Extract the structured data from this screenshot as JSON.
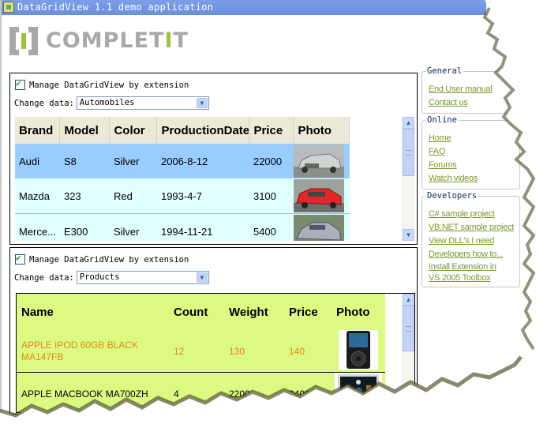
{
  "window": {
    "title": "DataGridView 1.1 demo application"
  },
  "logo": {
    "text_main": "COMPLET",
    "text_accent": "I",
    "text_end": "T"
  },
  "panel1": {
    "checkbox_label": "Manage DataGridView by extension",
    "checkbox_checked": true,
    "change_label": "Change data:",
    "combo_value": "Automobiles",
    "columns": [
      "Brand",
      "Model",
      "Color",
      "ProductionDate",
      "Price",
      "Photo"
    ],
    "rows": [
      {
        "brand": "Audi",
        "model": "S8",
        "color": "Silver",
        "date": "2006-8-12",
        "price": "22000",
        "photo": "silver-car",
        "selected": true
      },
      {
        "brand": "Mazda",
        "model": "323",
        "color": "Red",
        "date": "1993-4-7",
        "price": "3100",
        "photo": "red-car",
        "selected": false
      },
      {
        "brand": "Merce...",
        "model": "E300",
        "color": "Silver",
        "date": "1994-11-21",
        "price": "5400",
        "photo": "silver-sedan",
        "selected": false
      }
    ]
  },
  "panel2": {
    "checkbox_label": "Manage DataGridView by extension",
    "checkbox_checked": true,
    "change_label": "Change data:",
    "combo_value": "Products",
    "columns": [
      "Name",
      "Count",
      "Weight",
      "Price",
      "Photo"
    ],
    "rows": [
      {
        "name": "APPLE IPOD 60GB BLACK MA147FB",
        "count": "12",
        "weight": "130",
        "price": "140",
        "photo": "ipod",
        "highlight": true
      },
      {
        "name": "APPLE MACBOOK MA700ZH",
        "count": "4",
        "weight": "2200",
        "price": "2400",
        "photo": "macbook",
        "highlight": false
      }
    ]
  },
  "sidebar": {
    "groups": [
      {
        "title": "General",
        "links": [
          "End User manual",
          "Contact us"
        ]
      },
      {
        "title": "Online",
        "links": [
          "Home",
          "FAQ",
          "Forums",
          "Watch videos"
        ]
      },
      {
        "title": "Developers",
        "links": [
          "C# sample project",
          "VB.NET sample project",
          "View DLL's I need",
          "Developers how to...",
          "Install Extension in VS 2005 Toolbox"
        ]
      }
    ]
  },
  "colors": {
    "titlebar": "#7d9ee6",
    "selected_row": "#99ccff",
    "row_bg": "#e0ffff",
    "products_bg": "#dcfa82",
    "highlight_text": "#e08a1e",
    "link": "#7a9a30"
  }
}
